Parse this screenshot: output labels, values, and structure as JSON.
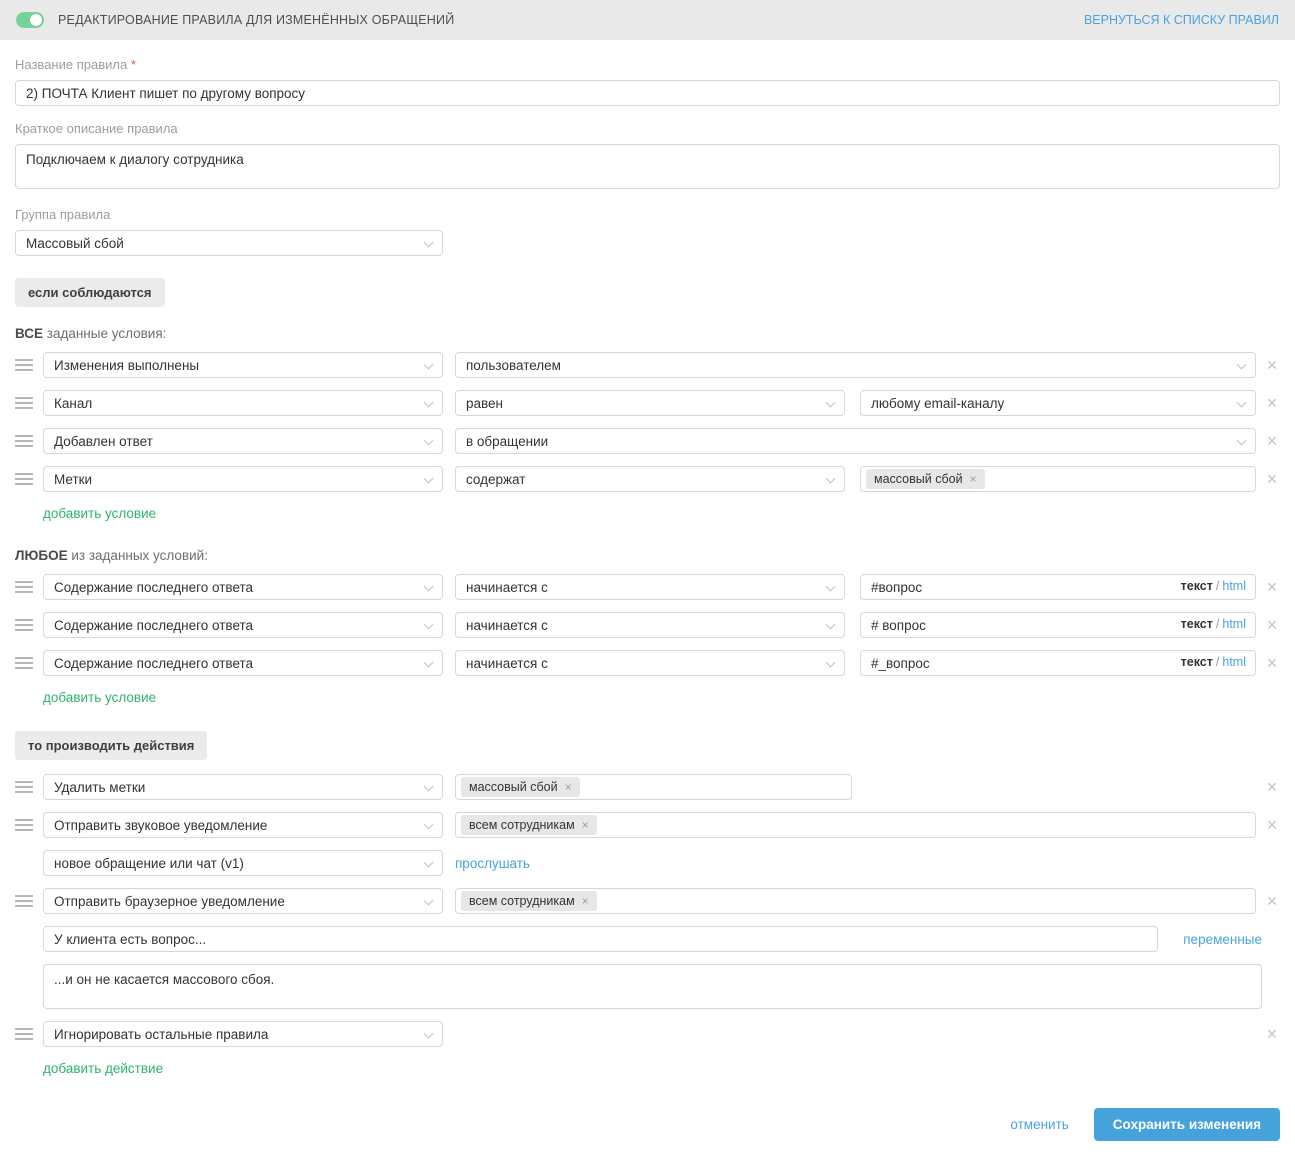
{
  "header": {
    "title": "РЕДАКТИРОВАНИЕ ПРАВИЛА ДЛЯ ИЗМЕНЁННЫХ ОБРАЩЕНИЙ",
    "back_link": "ВЕРНУТЬСЯ К СПИСКУ ПРАВИЛ",
    "toggle_state": "on"
  },
  "form": {
    "name_label": "Название правила",
    "required_asterisk": "*",
    "name_value": "2) ПОЧТА Клиент пишет по другому вопросу",
    "description_label": "Краткое описание правила",
    "description_value": "Подключаем к диалогу сотрудника",
    "group_label": "Группа правила",
    "group_value": "Массовый сбой"
  },
  "conditions": {
    "if_badge": "если соблюдаются",
    "all_heading_bold": "ВСЕ",
    "all_heading_rest": "заданные условия:",
    "all_rows": [
      {
        "field": "Изменения выполнены",
        "operator": "пользователем"
      },
      {
        "field": "Канал",
        "operator": "равен",
        "value": "любому email-каналу"
      },
      {
        "field": "Добавлен ответ",
        "operator": "в обращении"
      },
      {
        "field": "Метки",
        "operator": "содержат",
        "tag": "массовый сбой"
      }
    ],
    "add_condition_link": "добавить условие",
    "any_heading_bold": "ЛЮБОЕ",
    "any_heading_rest": "из заданных условий:",
    "any_rows": [
      {
        "field": "Содержание последнего ответа",
        "operator": "начинается с",
        "value": "#вопрос"
      },
      {
        "field": "Содержание последнего ответа",
        "operator": "начинается с",
        "value": "# вопрос"
      },
      {
        "field": "Содержание последнего ответа",
        "operator": "начинается с",
        "value": "#_вопрос"
      }
    ],
    "mode_text": "текст",
    "mode_separator": "/",
    "mode_html": "html"
  },
  "actions": {
    "then_badge": "то производить действия",
    "remove_tags": {
      "label": "Удалить метки",
      "tag": "массовый сбой"
    },
    "sound_notification": {
      "label": "Отправить звуковое уведомление",
      "tag": "всем сотрудникам",
      "sound_select": "новое обращение или чат (v1)",
      "listen_link": "прослушать"
    },
    "browser_notification": {
      "label": "Отправить браузерное уведомление",
      "tag": "всем сотрудникам",
      "title_value": "У клиента есть вопрос...",
      "variables_link": "переменные",
      "body_value": "...и он не касается массового сбоя."
    },
    "ignore_rules": {
      "label": "Игнорировать остальные правила"
    },
    "add_action_link": "добавить действие"
  },
  "footer": {
    "cancel_label": "отменить",
    "save_label": "Сохранить изменения"
  },
  "icons": {
    "close": "×",
    "remove_tag": "×"
  },
  "colors": {
    "accent_blue": "#47a4dd",
    "accent_green": "#2db56d",
    "toggle_green": "#77d29a",
    "header_bg": "#e9e9e9",
    "badge_bg": "#ebebeb",
    "chip_bg": "#e7e7e7",
    "border": "#d6d6d6",
    "required_red": "#e2574c",
    "save_button_bg": "#45a2db"
  }
}
